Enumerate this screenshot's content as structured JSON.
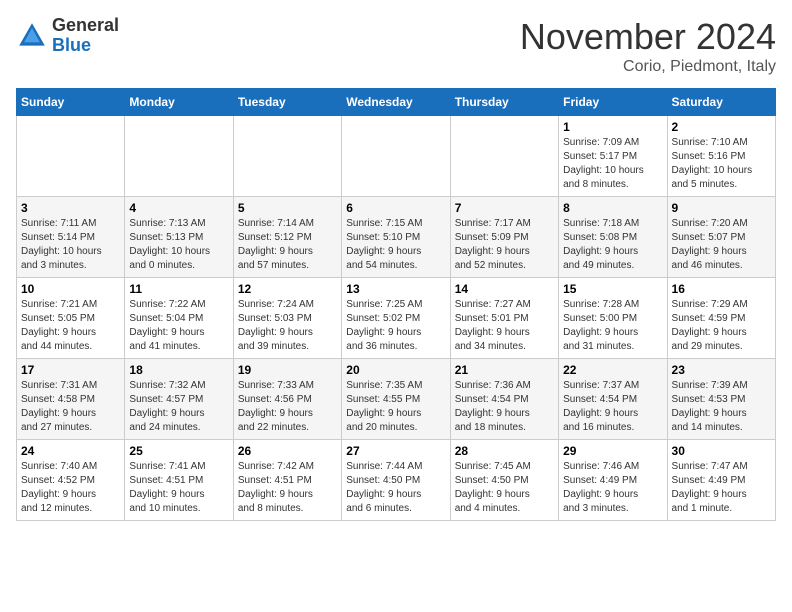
{
  "logo": {
    "general": "General",
    "blue": "Blue"
  },
  "header": {
    "title": "November 2024",
    "subtitle": "Corio, Piedmont, Italy"
  },
  "weekdays": [
    "Sunday",
    "Monday",
    "Tuesday",
    "Wednesday",
    "Thursday",
    "Friday",
    "Saturday"
  ],
  "weeks": [
    [
      {
        "day": "",
        "info": ""
      },
      {
        "day": "",
        "info": ""
      },
      {
        "day": "",
        "info": ""
      },
      {
        "day": "",
        "info": ""
      },
      {
        "day": "",
        "info": ""
      },
      {
        "day": "1",
        "info": "Sunrise: 7:09 AM\nSunset: 5:17 PM\nDaylight: 10 hours\nand 8 minutes."
      },
      {
        "day": "2",
        "info": "Sunrise: 7:10 AM\nSunset: 5:16 PM\nDaylight: 10 hours\nand 5 minutes."
      }
    ],
    [
      {
        "day": "3",
        "info": "Sunrise: 7:11 AM\nSunset: 5:14 PM\nDaylight: 10 hours\nand 3 minutes."
      },
      {
        "day": "4",
        "info": "Sunrise: 7:13 AM\nSunset: 5:13 PM\nDaylight: 10 hours\nand 0 minutes."
      },
      {
        "day": "5",
        "info": "Sunrise: 7:14 AM\nSunset: 5:12 PM\nDaylight: 9 hours\nand 57 minutes."
      },
      {
        "day": "6",
        "info": "Sunrise: 7:15 AM\nSunset: 5:10 PM\nDaylight: 9 hours\nand 54 minutes."
      },
      {
        "day": "7",
        "info": "Sunrise: 7:17 AM\nSunset: 5:09 PM\nDaylight: 9 hours\nand 52 minutes."
      },
      {
        "day": "8",
        "info": "Sunrise: 7:18 AM\nSunset: 5:08 PM\nDaylight: 9 hours\nand 49 minutes."
      },
      {
        "day": "9",
        "info": "Sunrise: 7:20 AM\nSunset: 5:07 PM\nDaylight: 9 hours\nand 46 minutes."
      }
    ],
    [
      {
        "day": "10",
        "info": "Sunrise: 7:21 AM\nSunset: 5:05 PM\nDaylight: 9 hours\nand 44 minutes."
      },
      {
        "day": "11",
        "info": "Sunrise: 7:22 AM\nSunset: 5:04 PM\nDaylight: 9 hours\nand 41 minutes."
      },
      {
        "day": "12",
        "info": "Sunrise: 7:24 AM\nSunset: 5:03 PM\nDaylight: 9 hours\nand 39 minutes."
      },
      {
        "day": "13",
        "info": "Sunrise: 7:25 AM\nSunset: 5:02 PM\nDaylight: 9 hours\nand 36 minutes."
      },
      {
        "day": "14",
        "info": "Sunrise: 7:27 AM\nSunset: 5:01 PM\nDaylight: 9 hours\nand 34 minutes."
      },
      {
        "day": "15",
        "info": "Sunrise: 7:28 AM\nSunset: 5:00 PM\nDaylight: 9 hours\nand 31 minutes."
      },
      {
        "day": "16",
        "info": "Sunrise: 7:29 AM\nSunset: 4:59 PM\nDaylight: 9 hours\nand 29 minutes."
      }
    ],
    [
      {
        "day": "17",
        "info": "Sunrise: 7:31 AM\nSunset: 4:58 PM\nDaylight: 9 hours\nand 27 minutes."
      },
      {
        "day": "18",
        "info": "Sunrise: 7:32 AM\nSunset: 4:57 PM\nDaylight: 9 hours\nand 24 minutes."
      },
      {
        "day": "19",
        "info": "Sunrise: 7:33 AM\nSunset: 4:56 PM\nDaylight: 9 hours\nand 22 minutes."
      },
      {
        "day": "20",
        "info": "Sunrise: 7:35 AM\nSunset: 4:55 PM\nDaylight: 9 hours\nand 20 minutes."
      },
      {
        "day": "21",
        "info": "Sunrise: 7:36 AM\nSunset: 4:54 PM\nDaylight: 9 hours\nand 18 minutes."
      },
      {
        "day": "22",
        "info": "Sunrise: 7:37 AM\nSunset: 4:54 PM\nDaylight: 9 hours\nand 16 minutes."
      },
      {
        "day": "23",
        "info": "Sunrise: 7:39 AM\nSunset: 4:53 PM\nDaylight: 9 hours\nand 14 minutes."
      }
    ],
    [
      {
        "day": "24",
        "info": "Sunrise: 7:40 AM\nSunset: 4:52 PM\nDaylight: 9 hours\nand 12 minutes."
      },
      {
        "day": "25",
        "info": "Sunrise: 7:41 AM\nSunset: 4:51 PM\nDaylight: 9 hours\nand 10 minutes."
      },
      {
        "day": "26",
        "info": "Sunrise: 7:42 AM\nSunset: 4:51 PM\nDaylight: 9 hours\nand 8 minutes."
      },
      {
        "day": "27",
        "info": "Sunrise: 7:44 AM\nSunset: 4:50 PM\nDaylight: 9 hours\nand 6 minutes."
      },
      {
        "day": "28",
        "info": "Sunrise: 7:45 AM\nSunset: 4:50 PM\nDaylight: 9 hours\nand 4 minutes."
      },
      {
        "day": "29",
        "info": "Sunrise: 7:46 AM\nSunset: 4:49 PM\nDaylight: 9 hours\nand 3 minutes."
      },
      {
        "day": "30",
        "info": "Sunrise: 7:47 AM\nSunset: 4:49 PM\nDaylight: 9 hours\nand 1 minute."
      }
    ]
  ]
}
